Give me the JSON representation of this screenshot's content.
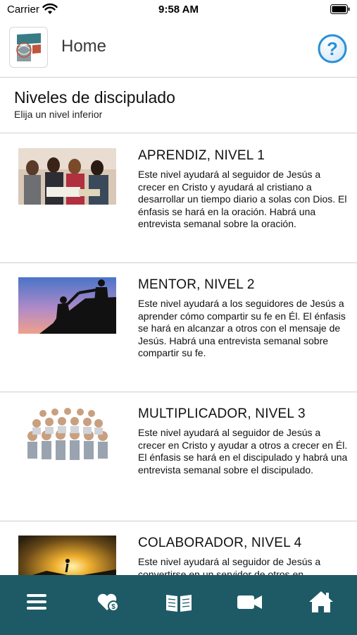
{
  "status_bar": {
    "carrier": "Carrier",
    "time": "9:58 AM"
  },
  "header": {
    "title": "Home",
    "help_icon": "question-circle-icon"
  },
  "page": {
    "title": "Niveles de discipulado",
    "subtitle": "Elija un nivel inferior"
  },
  "levels": [
    {
      "title": "APRENDIZ, NIVEL 1",
      "description": "Este nivel ayudará al seguidor de Jesús a crecer en Cristo y ayudará al cristiano a desarrollar un tiempo diario a solas con Dios. El énfasis se hará en la oración. Habrá una entrevista semanal sobre la oración.",
      "image": "group-bible-study-photo"
    },
    {
      "title": "MENTOR, NIVEL 2",
      "description": "Este nivel ayudará a los seguidores de Jesús a aprender cómo compartir su fe en Él. El énfasis se hará en alcanzar a otros con el mensaje de Jesús. Habrá una entrevista semanal sobre compartir su fe.",
      "image": "climbers-helping-photo"
    },
    {
      "title": "MULTIPLICADOR, NIVEL 3",
      "description": "Este nivel ayudará al seguidor de Jesús a crecer en Cristo y ayudar a otros a crecer en Él. El énfasis se hará en el discipulado y habrá una entrevista semanal sobre el discipulado.",
      "image": "crowd-of-people-photo"
    },
    {
      "title": "COLABORADOR, NIVEL 4",
      "description": "Este nivel ayudará al seguidor de Jesús a convertirse en un servidor de otros en",
      "image": "sunset-climbers-photo"
    }
  ],
  "tab_bar": {
    "tabs": [
      "menu-icon",
      "donate-heart-icon",
      "bible-book-icon",
      "video-camera-icon",
      "home-icon"
    ]
  },
  "colors": {
    "tab_bar": "#1e5a66",
    "help_blue": "#2a8fd6",
    "divider": "#cfcfcf"
  }
}
